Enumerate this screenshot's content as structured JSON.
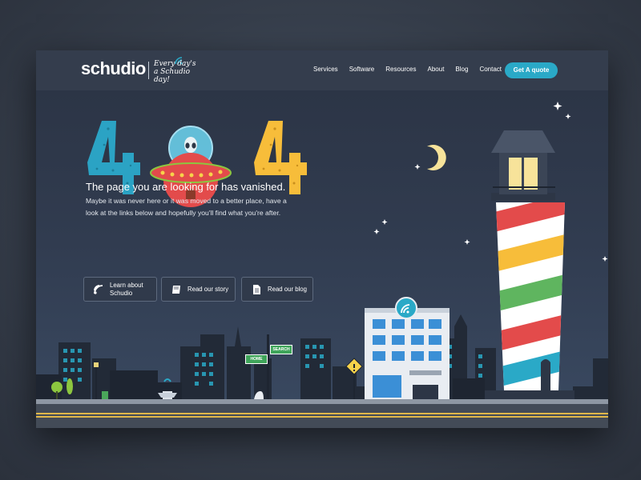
{
  "brand": {
    "name": "schudio",
    "tagline_line1": "Every day's",
    "tagline_line2": "a Schudio day!",
    "accent": "#2aa9c7"
  },
  "nav": {
    "items": [
      "Services",
      "Software",
      "Resources",
      "About",
      "Blog",
      "Contact"
    ],
    "cta": "Get A quote"
  },
  "error": {
    "code_left": "4",
    "code_right": "4",
    "headline": "The page you are looking for has vanished.",
    "body": "Maybe it was never here or it was moved to a better place, have a look at the links below and hopefully you'll find what you're after."
  },
  "links": [
    {
      "label": "Learn about Schudio",
      "icon": "wifi-icon"
    },
    {
      "label": "Read our story",
      "icon": "book-icon"
    },
    {
      "label": "Read our blog",
      "icon": "document-icon"
    }
  ],
  "signs": {
    "home": "HOME",
    "search": "SEARCH"
  }
}
